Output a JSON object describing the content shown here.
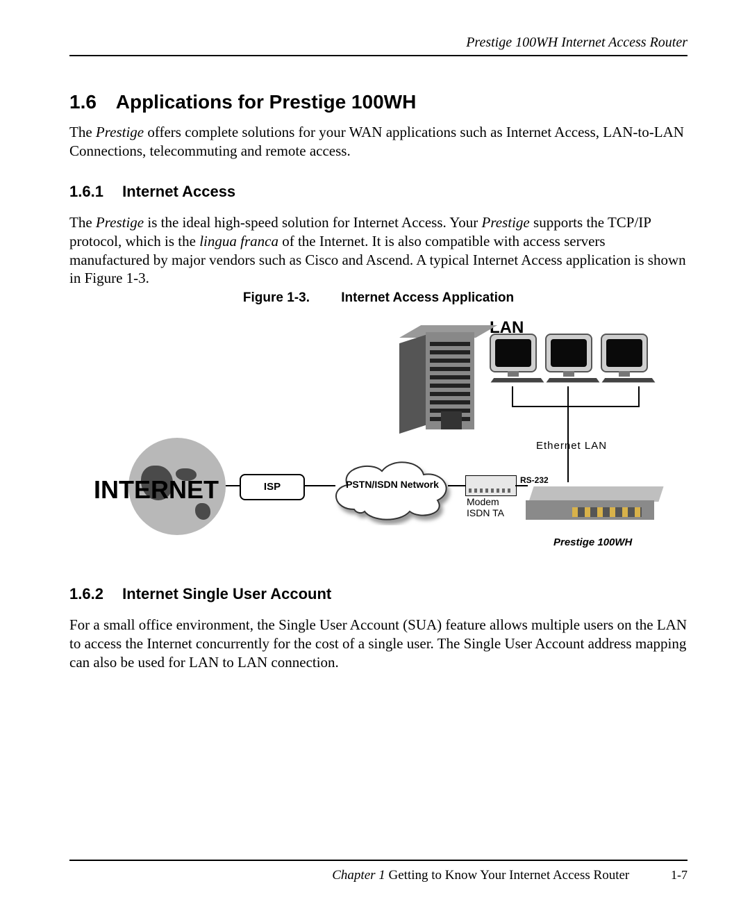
{
  "header": {
    "title": "Prestige 100WH Internet Access Router"
  },
  "section": {
    "number": "1.6",
    "title": "Applications for Prestige 100WH",
    "intro_pre": "The ",
    "intro_em": "Prestige",
    "intro_post": " offers complete solutions for your WAN applications such as Internet Access, LAN-to-LAN Connections, telecommuting and remote access."
  },
  "sub1": {
    "number": "1.6.1",
    "title": "Internet Access",
    "p_a": "The ",
    "p_em1": "Prestige",
    "p_b": " is the ideal high-speed solution for Internet Access. Your ",
    "p_em2": "Prestige",
    "p_c": " supports the TCP/IP protocol, which is the ",
    "p_em3": "lingua franca",
    "p_d": " of the Internet. It is also compatible with access servers manufactured by major vendors such as Cisco and Ascend. A typical Internet Access application is shown in Figure 1-3."
  },
  "figure": {
    "label": "Figure 1-3.",
    "title": "Internet Access Application",
    "lan": "LAN",
    "ethernet": "Ethernet LAN",
    "internet": "INTERNET",
    "isp": "ISP",
    "cloud": "PSTN/ISDN Network",
    "modem_line1": "Modem",
    "modem_line2": "ISDN TA",
    "rs232": "RS-232",
    "device": "Prestige 100WH"
  },
  "sub2": {
    "number": "1.6.2",
    "title": "Internet Single User Account",
    "body": "For a small office environment, the Single User Account (SUA) feature allows multiple users on the LAN to access the Internet concurrently for the cost of a single user. The Single User Account address mapping can also be used for LAN to LAN connection."
  },
  "footer": {
    "chapter_em": "Chapter 1 ",
    "chapter_rest": "Getting to Know Your Internet Access Router",
    "pagenum": "1-7"
  }
}
